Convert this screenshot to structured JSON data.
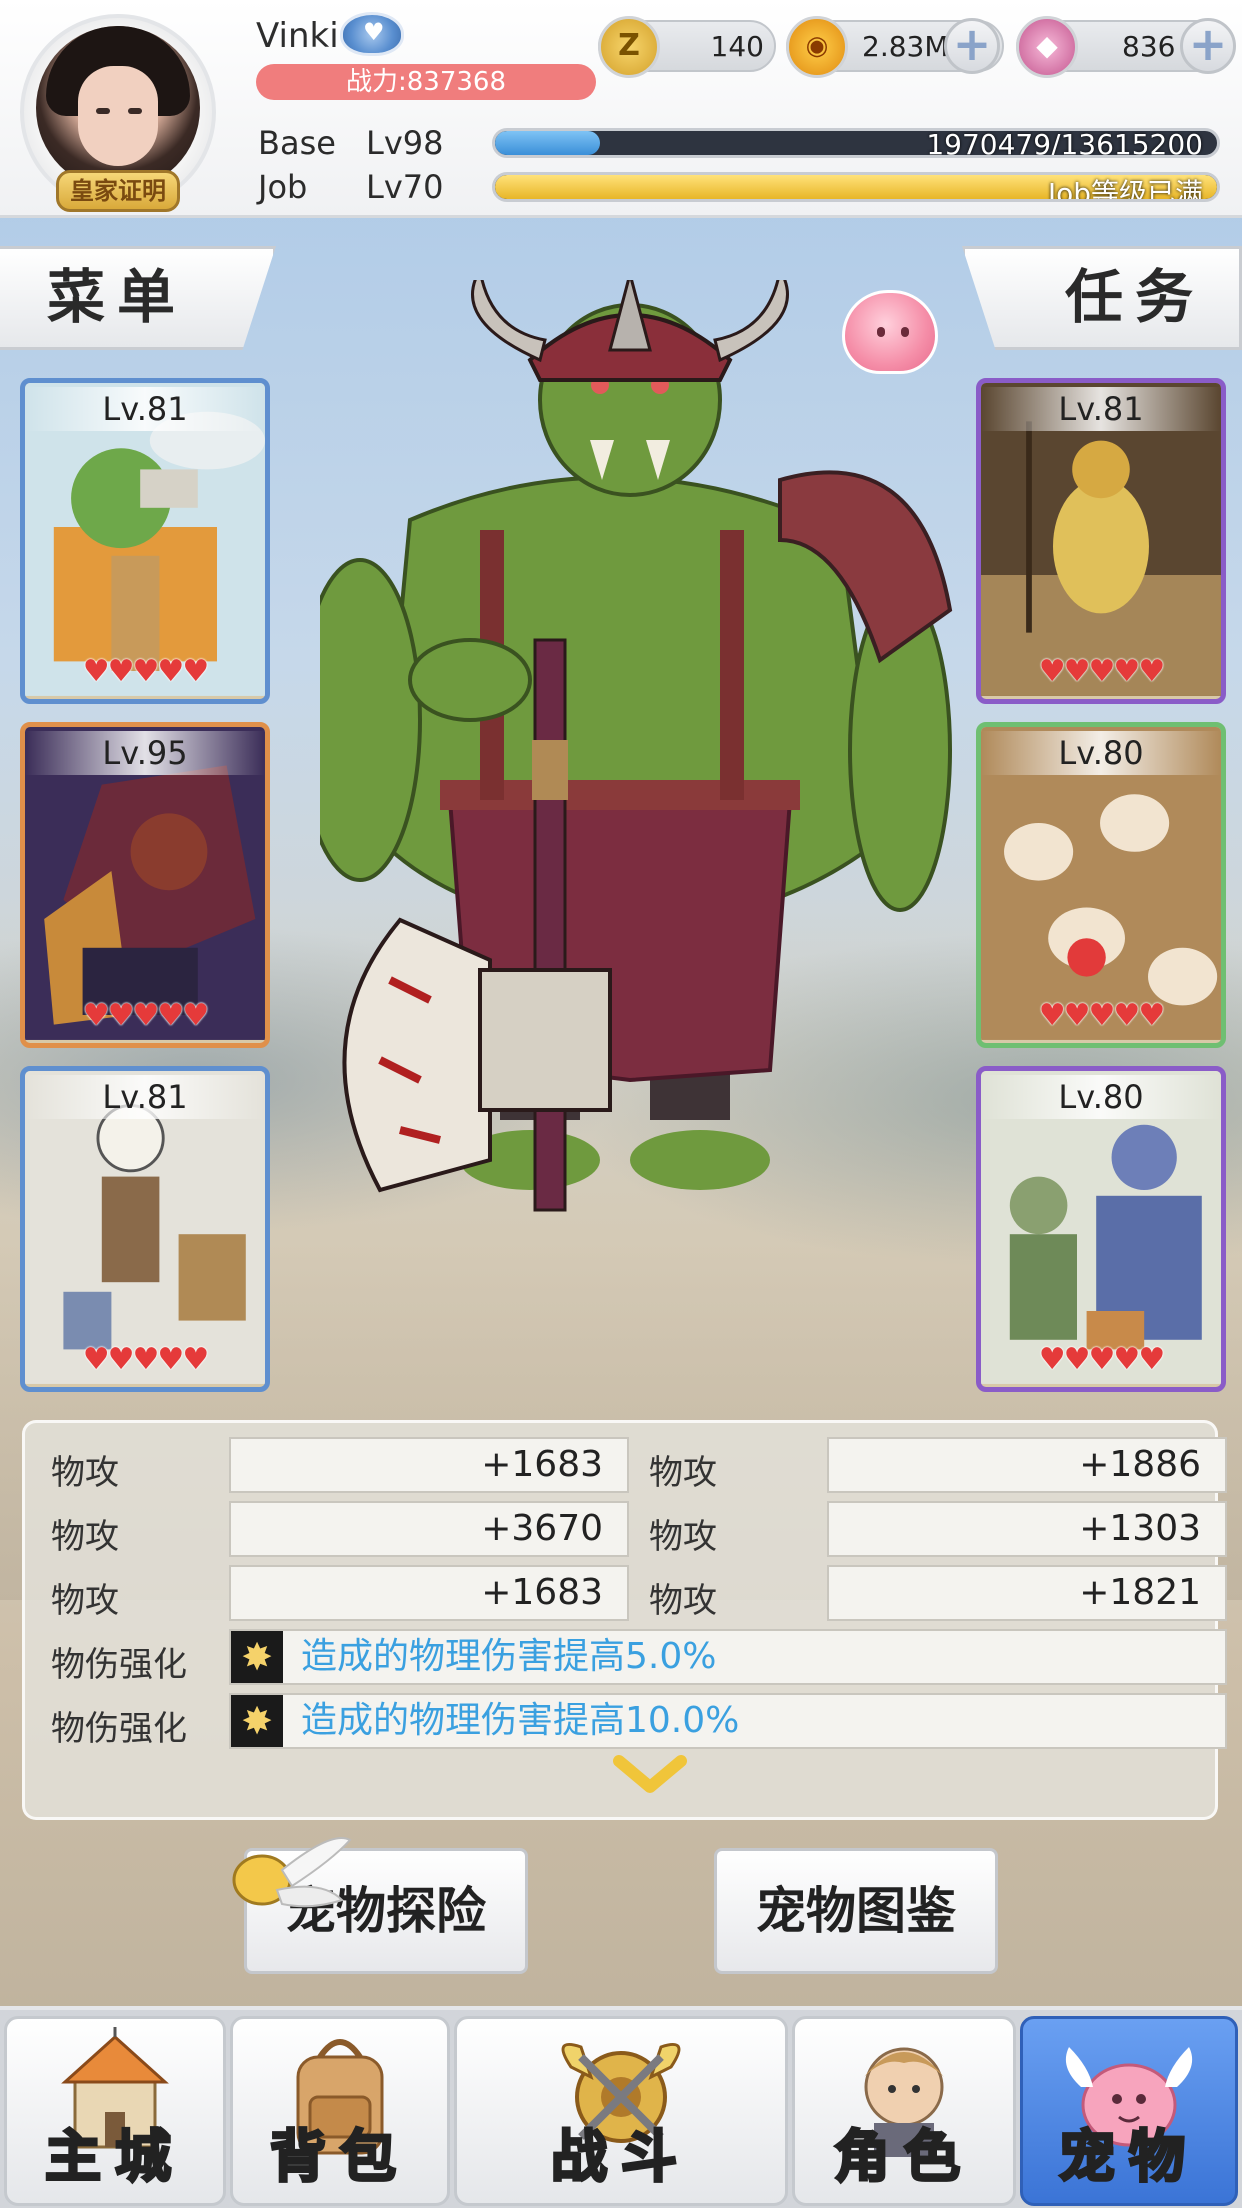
{
  "player": {
    "name": "Vinki",
    "power": "战力:837368",
    "badge": "皇家证明",
    "base_label": "Base",
    "base_level": "Lv98",
    "base_exp": "1970479/13615200",
    "base_progress": 0.145,
    "job_label": "Job",
    "job_level": "Lv70",
    "job_exp": "Job等级已满",
    "job_progress": 1.0
  },
  "currencies": [
    {
      "icon": "zeny-coin-icon",
      "value": "140",
      "color": "#e2b43a"
    },
    {
      "icon": "gold-poring-icon",
      "value": "2.83M",
      "color": "#e8a21e"
    },
    {
      "icon": "pink-gem-icon",
      "value": "836",
      "color": "#d96fa7"
    }
  ],
  "side": {
    "menu_label": "菜单",
    "quest_label": "任务"
  },
  "cards_left": [
    {
      "level": "Lv.81",
      "hearts": "♥♥♥♥♥",
      "border": "#5f8fcf"
    },
    {
      "level": "Lv.95",
      "hearts": "♥♥♥♥♥",
      "border": "#e0904a"
    },
    {
      "level": "Lv.81",
      "hearts": "♥♥♥♥♥",
      "border": "#5f8fcf"
    }
  ],
  "cards_right": [
    {
      "level": "Lv.81",
      "hearts": "♥♥♥♥♥",
      "border": "#8a5cc8"
    },
    {
      "level": "Lv.80",
      "hearts": "♥♥♥♥♥",
      "border": "#6fbf72"
    },
    {
      "level": "Lv.80",
      "hearts": "♥♥♥♥♥",
      "border": "#8a5cc8"
    }
  ],
  "stats": {
    "rows": [
      {
        "left_label": "物攻",
        "left_value": "+1683",
        "right_label": "物攻",
        "right_value": "+1886"
      },
      {
        "left_label": "物攻",
        "left_value": "+3670",
        "right_label": "物攻",
        "right_value": "+1303"
      },
      {
        "left_label": "物攻",
        "left_value": "+1683",
        "right_label": "物攻",
        "right_value": "+1821"
      }
    ],
    "skills": [
      {
        "label": "物伤强化",
        "text": "造成的物理伤害提高5.0%"
      },
      {
        "label": "物伤强化",
        "text": "造成的物理伤害提高10.0%"
      }
    ]
  },
  "actions": {
    "explore": "宠物探险",
    "codex": "宠物图鉴"
  },
  "nav": {
    "items": [
      {
        "label": "主城",
        "icon": "castle-icon"
      },
      {
        "label": "背包",
        "icon": "backpack-icon"
      },
      {
        "label": "战斗",
        "icon": "battle-shield-icon"
      },
      {
        "label": "角色",
        "icon": "character-icon"
      },
      {
        "label": "宠物",
        "icon": "pet-poring-icon"
      }
    ],
    "active": 4
  }
}
